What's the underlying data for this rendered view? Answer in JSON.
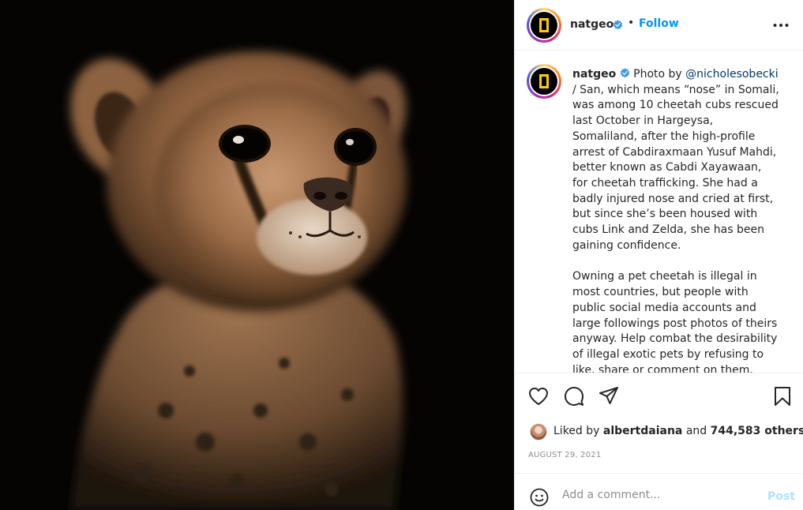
{
  "post": {
    "image_alt": "cheetah-cub-photo",
    "account": {
      "username": "natgeo",
      "verified": true,
      "follow_label": "Follow",
      "separator": "•"
    },
    "caption": {
      "username": "natgeo",
      "prefix": "Photo by ",
      "mention": "@nicholesobecki",
      "paragraph1_rest": " / San, which means “nose” in Somali, was among 10 cheetah cubs rescued last October in Hargeysa, Somaliland, after the high-profile arrest of Cabdiraxmaan Yusuf Mahdi, better known as Cabdi Xayawaan, for cheetah trafficking. She had a badly injured nose and cried at first, but since she’s been housed with cubs Link and Zelda, she has been gaining confidence.",
      "paragraph2": "Owning a pet cheetah is illegal in most countries, but people with public social media accounts and large followings post photos of theirs anyway. Help combat the desirability of illegal exotic pets by refusing to like, share or comment on them."
    },
    "likes": {
      "prefix": "Liked by ",
      "liker": "albertdaiana",
      "joiner": " and ",
      "others": "744,583 others"
    },
    "date": "AUGUST 29, 2021",
    "comment_box": {
      "placeholder": "Add a comment...",
      "post_label": "Post"
    }
  },
  "icons": {
    "header_more": "more-horizontal-icon",
    "like": "heart-icon",
    "comment": "comment-icon",
    "share": "send-icon",
    "save": "bookmark-icon",
    "emoji": "emoji-icon",
    "verified": "verified-badge-icon"
  },
  "colors": {
    "follow_blue": "#0095f6",
    "verified_blue": "#3897f0",
    "post_disabled": "#b2dffc",
    "natgeo_yellow": "#ffcc00",
    "mention": "#00376b"
  }
}
